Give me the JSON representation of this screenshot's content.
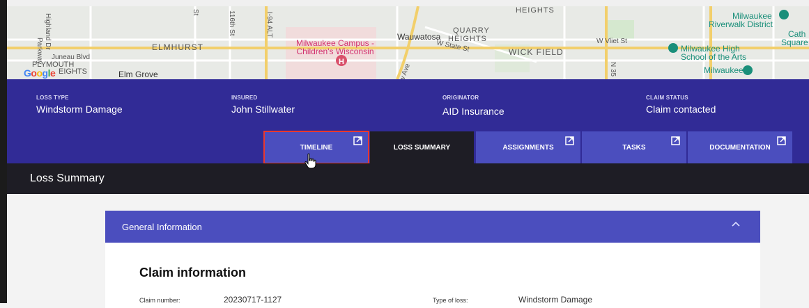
{
  "map": {
    "labels": {
      "highland": "Highland Dr",
      "parkway": "Parkway",
      "juneau": "Juneau Blvd",
      "plymouth": "PLYMOUTH",
      "heights_left": "EIGHTS",
      "elmhurst": "ELMHURST",
      "elm_grove": "Elm Grove",
      "st_116": "116th St",
      "i94": "I-94 ALT",
      "st_small": "St",
      "milwaukee_campus": "Milwaukee Campus -",
      "childrens": "Children's Wisconsin",
      "wauwatosa": "Wauwatosa",
      "quarry": "QUARRY",
      "heights_mid": "HEIGHTS",
      "heights_top": "HEIGHTS",
      "state_st": "W State St",
      "ave": "w Ave",
      "wick_field": "WICK FIELD",
      "vliet": "W Vliet St",
      "n35": "N 35",
      "riverwalk1": "Milwaukee",
      "riverwalk2": "Riverwalk District",
      "school1": "Milwaukee High",
      "school2": "School of the Arts",
      "milwaukee_bottom": "Milwaukee",
      "cath": "Cath",
      "square": "Square"
    },
    "google_letters": [
      "G",
      "o",
      "o",
      "g",
      "l",
      "e"
    ],
    "google_colors": [
      "#4285f4",
      "#ea4335",
      "#fbbc05",
      "#4285f4",
      "#34a853",
      "#ea4335"
    ]
  },
  "info": {
    "loss_type_label": "LOSS TYPE",
    "loss_type_value": "Windstorm Damage",
    "insured_label": "INSURED",
    "insured_value": "John Stillwater",
    "originator_label": "ORIGINATOR",
    "originator_value": "AID Insurance",
    "claim_status_label": "CLAIM STATUS",
    "claim_status_value": "Claim contacted"
  },
  "tabs": [
    {
      "label": "TIMELINE",
      "external": true,
      "highlighted": true
    },
    {
      "label": "LOSS SUMMARY",
      "external": false,
      "active": true
    },
    {
      "label": "ASSIGNMENTS",
      "external": true
    },
    {
      "label": "TASKS",
      "external": true
    },
    {
      "label": "DOCUMENTATION",
      "external": true
    }
  ],
  "section_title": "Loss Summary",
  "general_info": {
    "title": "General Information",
    "claim_info_title": "Claim information",
    "claim_number_label": "Claim number:",
    "claim_number_value": "20230717-1127",
    "type_of_loss_label": "Type of loss:",
    "type_of_loss_value": "Windstorm Damage"
  },
  "colors": {
    "band": "#312b96",
    "tab": "#4b4ebe",
    "dark": "#1e1d25",
    "highlight": "#e8382f"
  }
}
